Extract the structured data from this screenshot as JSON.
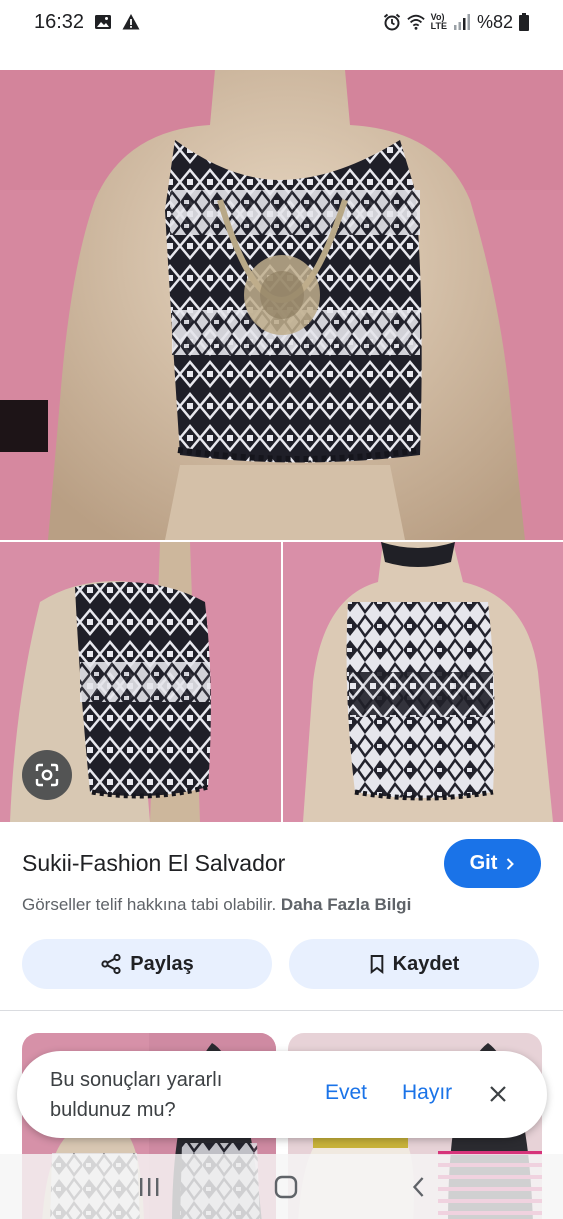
{
  "status": {
    "time": "16:32",
    "battery": "%82",
    "net_label_top": "Vo)",
    "net_label_bottom": "LTE"
  },
  "result": {
    "site_title": "Sukii-Fashion El Salvador",
    "go_label": "Git",
    "copyright_text": "Görseller telif hakkına tabi olabilir.",
    "learn_more": "Daha Fazla Bilgi",
    "share_label": "Paylaş",
    "save_label": "Kaydet"
  },
  "feedback": {
    "question": "Bu sonuçları yararlı buldunuz mu?",
    "yes": "Evet",
    "no": "Hayır"
  },
  "colors": {
    "accent": "#1a73e8",
    "chip_bg": "#e8f0fe",
    "wall_pink": "#d98fa8"
  },
  "icons": [
    "image-icon",
    "warning-icon",
    "alarm-icon",
    "wifi-icon",
    "signal-icon",
    "battery-icon",
    "lens-icon",
    "chevron-right-icon",
    "share-icon",
    "bookmark-icon",
    "close-icon",
    "recents-icon",
    "home-icon",
    "back-icon"
  ]
}
